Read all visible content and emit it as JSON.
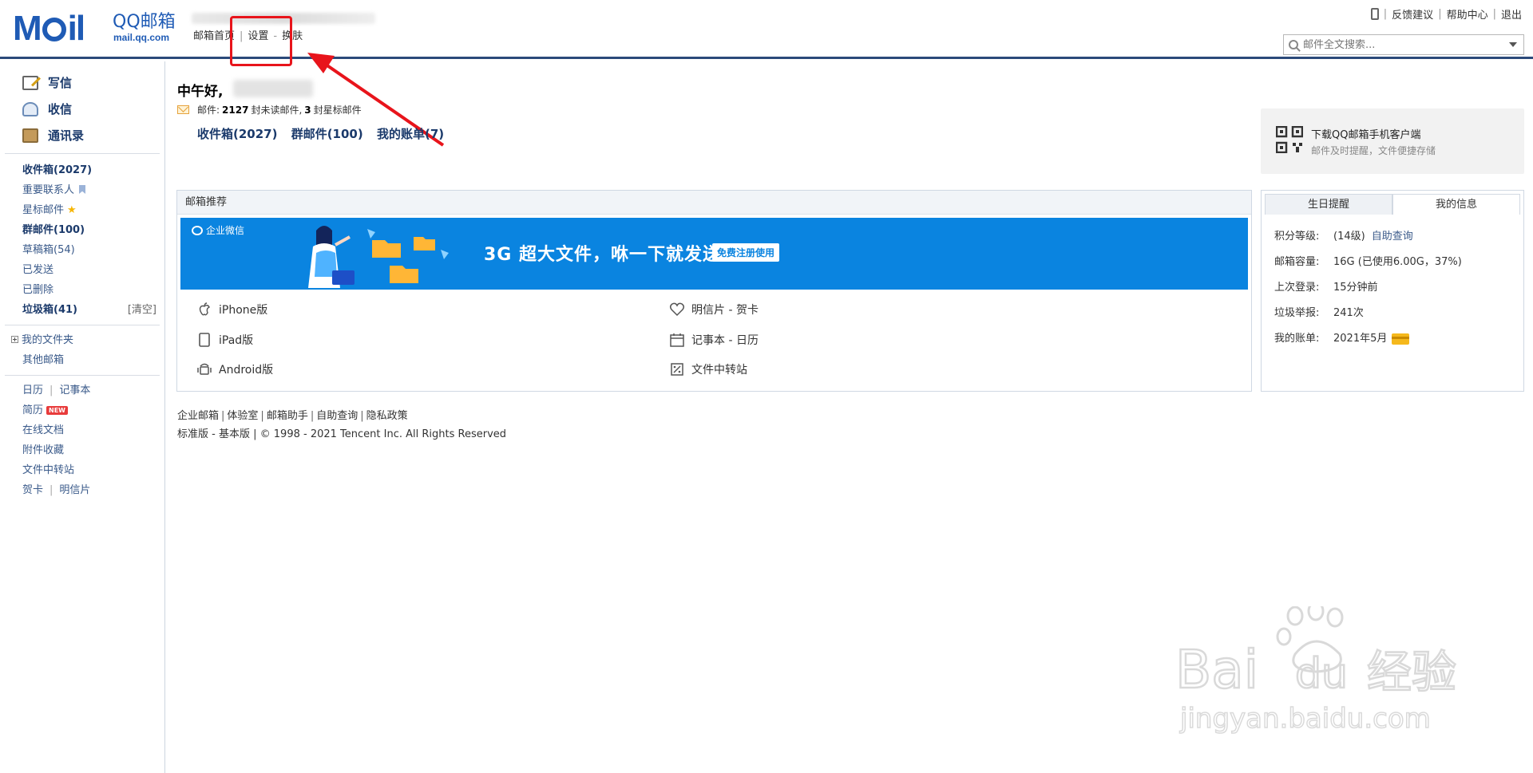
{
  "header": {
    "logo_mark": "M",
    "logo_mail_tail": "il",
    "logo_qq": "QQ邮箱",
    "logo_url": "mail.qq.com",
    "nav": [
      "邮箱首页",
      "设置",
      "换肤"
    ],
    "top_right": [
      "反馈建议",
      "帮助中心",
      "退出"
    ],
    "search_placeholder": "邮件全文搜索..."
  },
  "sidebar": {
    "main": [
      {
        "label": "写信",
        "icon": "write-icon"
      },
      {
        "label": "收信",
        "icon": "inbox-icon"
      },
      {
        "label": "通讯录",
        "icon": "contacts-icon"
      }
    ],
    "folders": {
      "inbox": "收件箱(2027)",
      "important": "重要联系人",
      "starred": "星标邮件",
      "group": "群邮件(100)",
      "drafts": "草稿箱(54)",
      "sent": "已发送",
      "deleted": "已删除",
      "spam": "垃圾箱(41)",
      "spam_clear": "[清空]",
      "my_folders": "我的文件夹",
      "other_mail": "其他邮箱",
      "calendar": "日历",
      "notes": "记事本",
      "resume": "简历",
      "resume_badge": "NEW",
      "docs": "在线文档",
      "attachments": "附件收藏",
      "file_transfer": "文件中转站",
      "greeting_card": "贺卡",
      "postcard": "明信片"
    }
  },
  "main": {
    "greeting": "中午好,",
    "summary_label": "邮件:",
    "unread_count": "2127",
    "unread_text": "封未读邮件,",
    "star_count": "3",
    "star_text": "封星标邮件",
    "quick_links": [
      "收件箱(2027)",
      "群邮件(100)",
      "我的账单(7)"
    ],
    "app_promo": {
      "title": "下载QQ邮箱手机客户端",
      "subtitle": "邮件及时提醒，文件便捷存储"
    },
    "recommend": {
      "heading": "邮箱推荐",
      "banner_brand": "企业微信",
      "banner_text": "3G 超大文件，咻一下就发送",
      "banner_button": "免费注册使用",
      "items_left": [
        "iPhone版",
        "iPad版",
        "Android版"
      ],
      "items_right": [
        "明信片 - 贺卡",
        "记事本 - 日历",
        "文件中转站"
      ]
    }
  },
  "info_panel": {
    "tabs": [
      "生日提醒",
      "我的信息"
    ],
    "rows": [
      {
        "key": "积分等级:",
        "value": "(14级)",
        "link": "自助查询"
      },
      {
        "key": "邮箱容量:",
        "value": "16G (已使用6.00G，37%)",
        "link": ""
      },
      {
        "key": "上次登录:",
        "value": "15分钟前",
        "link": ""
      },
      {
        "key": "垃圾举报:",
        "value": "241次",
        "link": ""
      },
      {
        "key": "我的账单:",
        "value": "2021年5月",
        "link": ""
      }
    ]
  },
  "footer": {
    "links": [
      "企业邮箱",
      "体验室",
      "邮箱助手",
      "自助查询",
      "隐私政策"
    ],
    "versions": [
      "标准版",
      "基本版"
    ],
    "copyright": "© 1998 - 2021 Tencent Inc. All Rights Reserved"
  },
  "watermark": {
    "brand": "Bai",
    "brand_tail": "du",
    "brand_cn": "经验",
    "url": "jingyan.baidu.com"
  },
  "colors": {
    "brand_blue": "#1f5bb5",
    "banner_blue": "#0a84e0",
    "highlight_red": "#e8141b",
    "link_navy": "#1b3a6b"
  }
}
